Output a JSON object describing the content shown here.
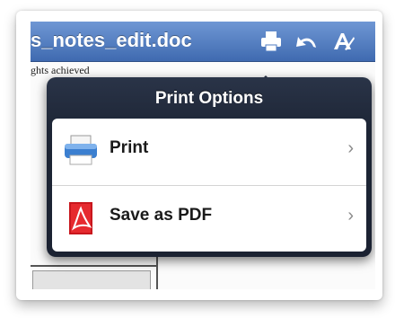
{
  "document": {
    "title": "s_notes_edit.doc",
    "body_line": "ghts achieved"
  },
  "toolbar": {
    "icons": [
      "printer-icon",
      "undo-arrow-icon",
      "text-format-icon"
    ]
  },
  "popover": {
    "title": "Print Options",
    "items": [
      {
        "label": "Print",
        "icon": "printer-icon"
      },
      {
        "label": "Save as PDF",
        "icon": "pdf-icon"
      }
    ]
  },
  "colors": {
    "toolbar": "#4f7bc0",
    "popover": "#1d2535",
    "list_bg": "#ffffff"
  }
}
